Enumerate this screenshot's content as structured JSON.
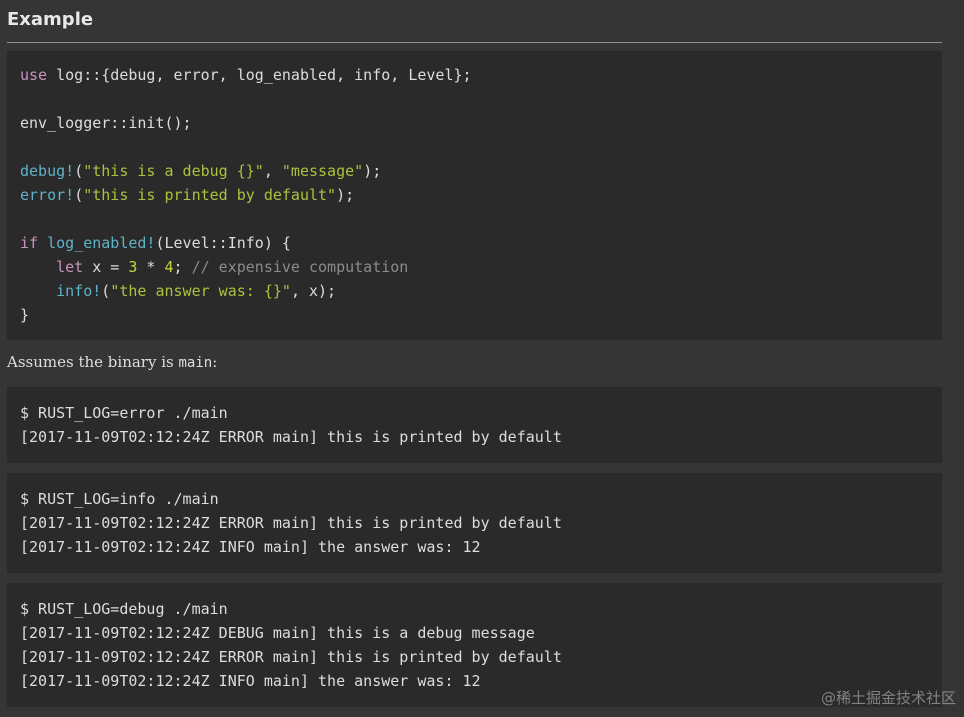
{
  "heading": "Example",
  "code": {
    "use_kw": "use",
    "use_rest": " log::{debug, error, log_enabled, info, Level};",
    "init_line": "env_logger::init();",
    "debug_mac": "debug!",
    "debug_p1": "(",
    "debug_s1": "\"this is a debug {}\"",
    "debug_p2": ", ",
    "debug_s2": "\"message\"",
    "debug_p3": ");",
    "error_mac": "error!",
    "error_p1": "(",
    "error_s1": "\"this is printed by default\"",
    "error_p2": ");",
    "if_kw": "if",
    "if_sp": " ",
    "log_enabled_mac": "log_enabled!",
    "if_rest": "(Level::Info) {",
    "let_indent": "    ",
    "let_kw": "let",
    "let_mid": " x = ",
    "num_3": "3",
    "mul": " * ",
    "num_4": "4",
    "semi": "; ",
    "comment": "// expensive computation",
    "info_indent": "    ",
    "info_mac": "info!",
    "info_p1": "(",
    "info_s1": "\"the answer was: {}\"",
    "info_p2": ", x);",
    "close_brace": "}"
  },
  "paragraph": {
    "text": "Assumes the binary is ",
    "code": "main",
    "suffix": ":"
  },
  "terminal_blocks": [
    {
      "lines": [
        "$ RUST_LOG=error ./main",
        "[2017-11-09T02:12:24Z ERROR main] this is printed by default"
      ]
    },
    {
      "lines": [
        "$ RUST_LOG=info ./main",
        "[2017-11-09T02:12:24Z ERROR main] this is printed by default",
        "[2017-11-09T02:12:24Z INFO main] the answer was: 12"
      ]
    },
    {
      "lines": [
        "$ RUST_LOG=debug ./main",
        "[2017-11-09T02:12:24Z DEBUG main] this is a debug message",
        "[2017-11-09T02:12:24Z ERROR main] this is printed by default",
        "[2017-11-09T02:12:24Z INFO main] the answer was: 12"
      ]
    }
  ],
  "watermark": "@稀土掘金技术社区"
}
